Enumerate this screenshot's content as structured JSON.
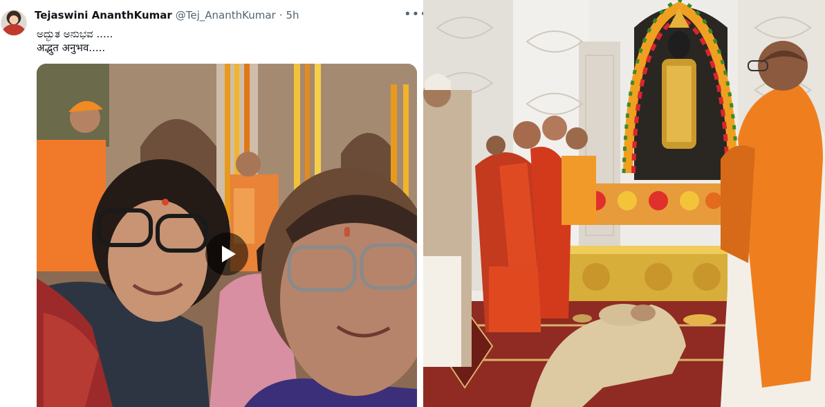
{
  "tweet": {
    "author_name": "Tejaswini AnanthKumar",
    "author_handle": "@Tej_AnanthKumar",
    "separator": "·",
    "time": "5h",
    "more_icon": "more-horizontal-icon",
    "text": "ಅದ್ಭುತ ಅನುಭವ .....\nअद्भुत अनुभव.....",
    "media": {
      "type": "video",
      "play_icon": "play-icon"
    }
  },
  "colors": {
    "name": "#0f1419",
    "secondary_text": "#536471",
    "saffron": "#e8791e",
    "temple_white": "#eeece8"
  }
}
